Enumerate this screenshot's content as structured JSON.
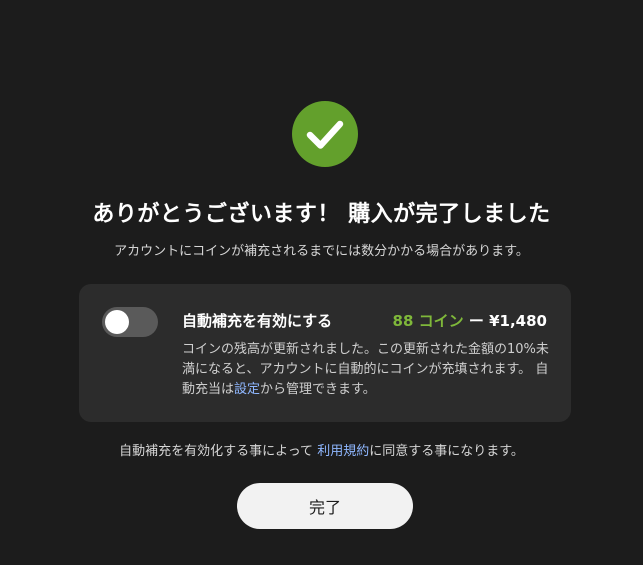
{
  "success": {
    "icon": "check-circle-icon",
    "title": "ありがとうございます！ 購入が完了しました",
    "subtitle": "アカウントにコインが補充されるまでには数分かかる場合があります。"
  },
  "autofill": {
    "enabled": false,
    "label": "自動補充を有効にする",
    "coins": "88 コイン",
    "separator": "ー",
    "price": "¥1,480",
    "desc_part1": "コインの残高が更新されました。この更新された金額の10%未満になると、アカウントに自動的にコインが充填されます。 自動充当は",
    "desc_link": "設定",
    "desc_part2": "から管理できます。"
  },
  "terms": {
    "prefix": "自動補充を有効化する事によって ",
    "link": "利用規約",
    "suffix": "に同意する事になります。"
  },
  "done_button": {
    "label": "完了"
  },
  "colors": {
    "background": "#1c1c1c",
    "card": "#2c2c2c",
    "success_green": "#63a02c",
    "coin_green": "#7fb83a",
    "link_blue": "#8fb7ff"
  }
}
